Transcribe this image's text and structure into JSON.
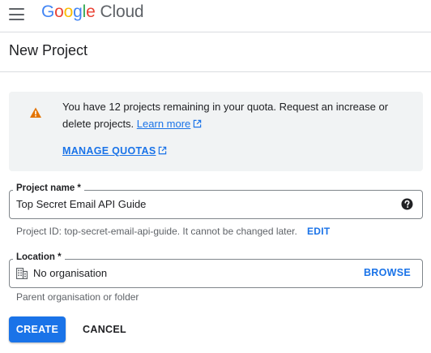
{
  "header": {
    "logo_google": "Google",
    "logo_cloud": "Cloud"
  },
  "page": {
    "title": "New Project"
  },
  "notice": {
    "text": "You have 12 projects remaining in your quota. Request an increase or delete projects.",
    "learn_more": "Learn more",
    "manage_quotas": "MANAGE QUOTAS"
  },
  "project_name": {
    "label": "Project name *",
    "value": "Top Secret Email API Guide",
    "help_icon": "help-circle-icon"
  },
  "project_id": {
    "text": "Project ID: top-secret-email-api-guide. It cannot be changed later.",
    "edit_label": "EDIT"
  },
  "location": {
    "label": "Location *",
    "value": "No organisation",
    "browse_label": "BROWSE",
    "hint": "Parent organisation or folder",
    "icon": "building-icon"
  },
  "actions": {
    "create_label": "CREATE",
    "cancel_label": "CANCEL"
  },
  "colors": {
    "accent": "#1a73e8",
    "warning": "#e37400",
    "notice_bg": "#f1f3f4"
  }
}
